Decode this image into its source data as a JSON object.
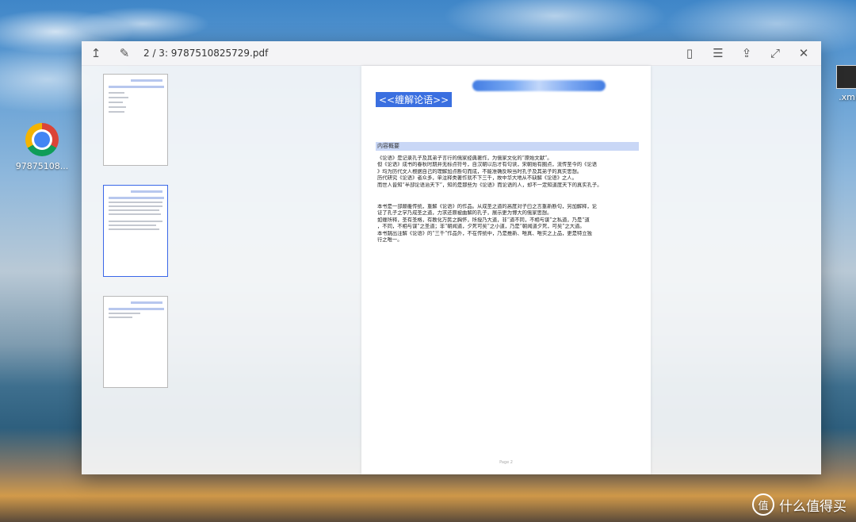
{
  "desktop": {
    "icons": [
      {
        "label": "97875108..."
      },
      {
        "label": ".xmi"
      }
    ]
  },
  "viewer": {
    "title": "2 / 3: 9787510825729.pdf",
    "icons": {
      "up": "↥",
      "pin": "✎",
      "page": "▯",
      "list": "☰",
      "share": "⇪",
      "expand": "⤢",
      "close": "✕"
    }
  },
  "document": {
    "title": "<<缠解论语>>",
    "section_title": "内容概要",
    "paragraph1": [
      "《论语》是记录孔子及其弟子言行的儒家经典著作，为儒家文化的“原始文献”。",
      "但《论语》成书的春秋时期并无标点符号，自汉朝以后才有句读，宋朝始有圈点，流传至今的《论语",
      "》均为历代文人根据自己的理解加点断句而成，不能准确反映当时孔子及其弟子的真实思想。",
      "历代研究《论语》者众多，单注释类著作就不下三千，故中华大地从不缺解《论语》之人。",
      "而世人皆知“半部论语治天下”，知的是那些为《论语》而论语的人，却不一定知道度天下的真实孔子。"
    ],
    "paragraph2": [
      "本书是一部颠覆传统，重解《论语》的作品。从成圣之道的高度对子曰之言重新断句，另加解释，论",
      "证了孔子之学乃成圣之道，力求还原被曲解的孔子，展示更为博大的儒家思想。",
      "如缠所释，圣有圣格，有教化万民之胸怀，所授乃大道，非“道不同，不相与谋”之私道，乃是“道",
      "，不同，不相与谋”之圣道；非“朝闻道，夕死可矣”之小道，乃是“朝闻道夕死，可矣”之大道。",
      "本书跳出注解《论语》的“三千”作品外，不在传统中，乃是推新、唯真、唯实之上品，更是特立独",
      "行之唯一。"
    ],
    "footer": "Page 2"
  },
  "watermark": {
    "logo": "值",
    "text": "什么值得买"
  }
}
